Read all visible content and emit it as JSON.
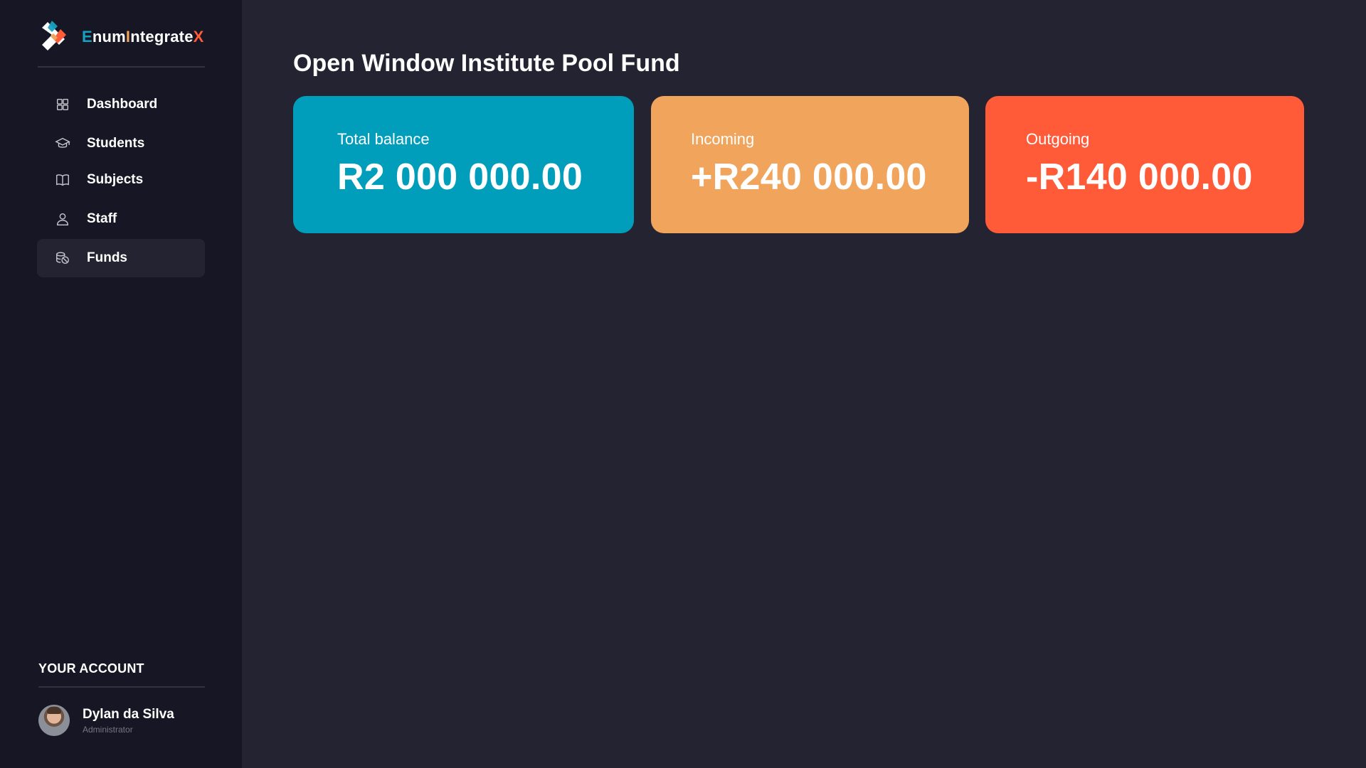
{
  "brand": {
    "name_parts": [
      "E",
      "num",
      "I",
      "ntegrate",
      "X"
    ],
    "colors": {
      "blue": "#17a1c1",
      "orange": "#f0a45c",
      "red": "#ff5b38"
    }
  },
  "nav": {
    "items": [
      {
        "label": "Dashboard",
        "icon": "grid-icon",
        "active": false
      },
      {
        "label": "Students",
        "icon": "graduation-cap-icon",
        "active": false
      },
      {
        "label": "Subjects",
        "icon": "book-icon",
        "active": false
      },
      {
        "label": "Staff",
        "icon": "user-icon",
        "active": false
      },
      {
        "label": "Funds",
        "icon": "coins-icon",
        "active": true
      }
    ]
  },
  "account": {
    "title": "YOUR ACCOUNT",
    "user_name": "Dylan da Silva",
    "user_role": "Administrator"
  },
  "main": {
    "title": "Open Window Institute Pool Fund",
    "cards": [
      {
        "label": "Total balance",
        "value": "R2 000 000.00",
        "color": "#019ebc"
      },
      {
        "label": "Incoming",
        "value": "+R240 000.00",
        "color": "#f0a45c"
      },
      {
        "label": "Outgoing",
        "value": "-R140 000.00",
        "color": "#ff5b38"
      }
    ]
  },
  "colors": {
    "sidebar_bg": "#171624",
    "main_bg": "#242331",
    "active_item_bg": "#242331"
  }
}
